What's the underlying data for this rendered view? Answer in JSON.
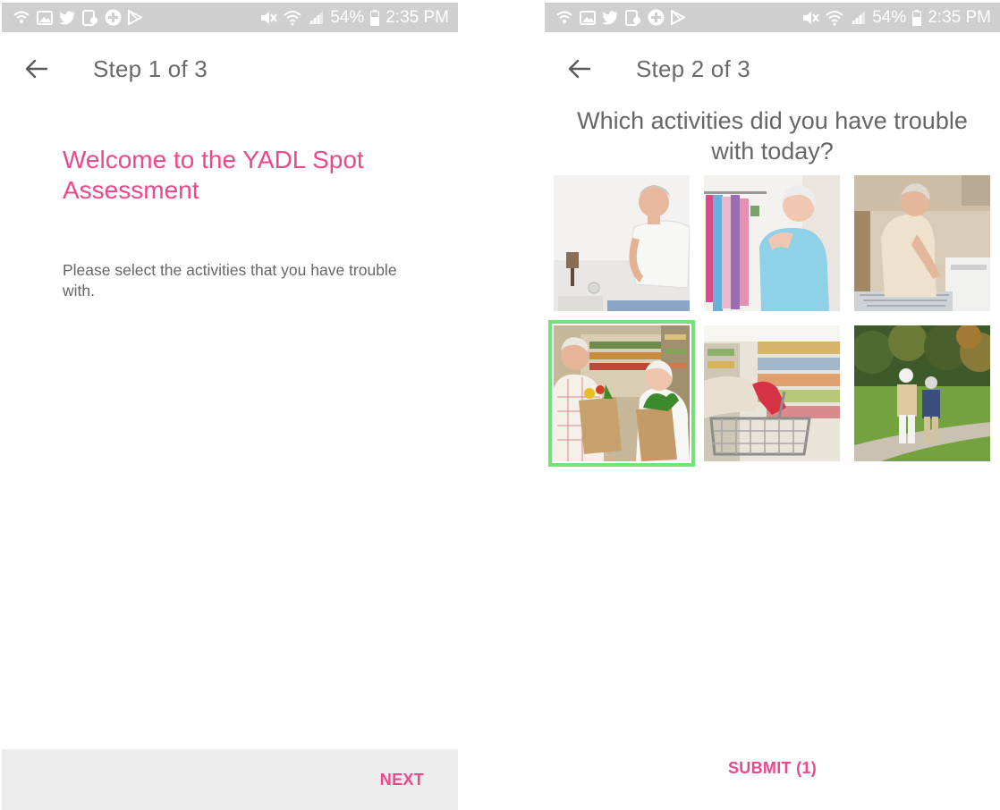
{
  "status_bar": {
    "left_icons": [
      "wifi-call-icon",
      "image-icon",
      "twitter-icon",
      "cast-icon",
      "plus-circle-icon",
      "play-store-icon"
    ],
    "right_icons": [
      "mute-icon",
      "wifi-icon",
      "signal-icon",
      "battery-icon"
    ],
    "battery": "54%",
    "time": "2:35 PM"
  },
  "screen1": {
    "toolbar_title": "Step 1 of 3",
    "welcome_title": "Welcome to the YADL Spot Assessment",
    "body_text": "Please select the activities that you have trouble with.",
    "next_label": "NEXT"
  },
  "screen2": {
    "toolbar_title": "Step 2 of 3",
    "question": "Which activities did you have trouble with today?",
    "submit_label": "SUBMIT (1)",
    "activities": [
      {
        "image": "man-sitting-on-bed",
        "selected": false
      },
      {
        "image": "woman-choosing-clothes",
        "selected": false
      },
      {
        "image": "man-loading-dishwasher",
        "selected": false
      },
      {
        "image": "couple-carrying-groceries",
        "selected": true
      },
      {
        "image": "shopping-cart-in-store",
        "selected": false
      },
      {
        "image": "couple-walking-in-park",
        "selected": false
      }
    ]
  },
  "colors": {
    "accent": "#f0468c",
    "selection": "#73e07a",
    "status_bar": "#cfcfcf",
    "bottom_bar": "#ececec",
    "text_gray": "#666666"
  }
}
